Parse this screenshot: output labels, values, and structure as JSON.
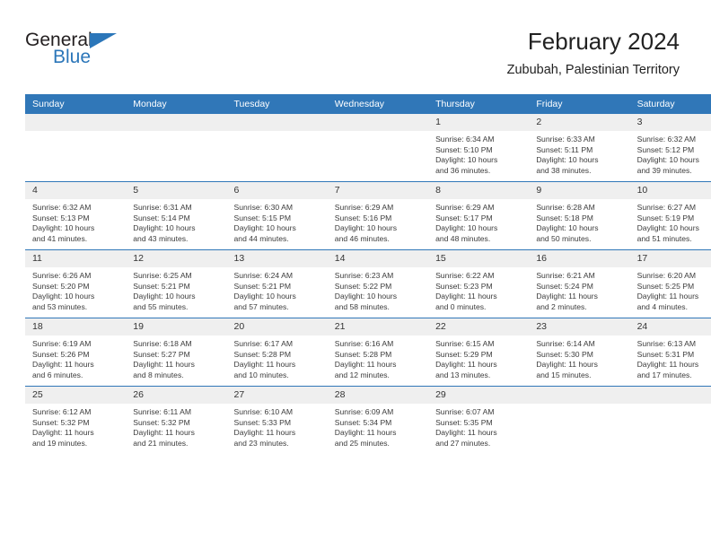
{
  "brand": {
    "name_part1": "General",
    "name_part2": "Blue"
  },
  "header": {
    "title": "February 2024",
    "subtitle": "Zububah, Palestinian Territory"
  },
  "colors": {
    "header_blue": "#3077b8",
    "brand_blue": "#2b76b9",
    "daynum_band": "#efefef",
    "text": "#3b3b3b"
  },
  "weekday_headers": [
    "Sunday",
    "Monday",
    "Tuesday",
    "Wednesday",
    "Thursday",
    "Friday",
    "Saturday"
  ],
  "weeks": [
    [
      {
        "day": "",
        "blank": true,
        "sunrise": "",
        "sunset": "",
        "daylight_l1": "",
        "daylight_l2": ""
      },
      {
        "day": "",
        "blank": true,
        "sunrise": "",
        "sunset": "",
        "daylight_l1": "",
        "daylight_l2": ""
      },
      {
        "day": "",
        "blank": true,
        "sunrise": "",
        "sunset": "",
        "daylight_l1": "",
        "daylight_l2": ""
      },
      {
        "day": "",
        "blank": true,
        "sunrise": "",
        "sunset": "",
        "daylight_l1": "",
        "daylight_l2": ""
      },
      {
        "day": "1",
        "blank": false,
        "sunrise": "Sunrise: 6:34 AM",
        "sunset": "Sunset: 5:10 PM",
        "daylight_l1": "Daylight: 10 hours",
        "daylight_l2": "and 36 minutes."
      },
      {
        "day": "2",
        "blank": false,
        "sunrise": "Sunrise: 6:33 AM",
        "sunset": "Sunset: 5:11 PM",
        "daylight_l1": "Daylight: 10 hours",
        "daylight_l2": "and 38 minutes."
      },
      {
        "day": "3",
        "blank": false,
        "sunrise": "Sunrise: 6:32 AM",
        "sunset": "Sunset: 5:12 PM",
        "daylight_l1": "Daylight: 10 hours",
        "daylight_l2": "and 39 minutes."
      }
    ],
    [
      {
        "day": "4",
        "blank": false,
        "sunrise": "Sunrise: 6:32 AM",
        "sunset": "Sunset: 5:13 PM",
        "daylight_l1": "Daylight: 10 hours",
        "daylight_l2": "and 41 minutes."
      },
      {
        "day": "5",
        "blank": false,
        "sunrise": "Sunrise: 6:31 AM",
        "sunset": "Sunset: 5:14 PM",
        "daylight_l1": "Daylight: 10 hours",
        "daylight_l2": "and 43 minutes."
      },
      {
        "day": "6",
        "blank": false,
        "sunrise": "Sunrise: 6:30 AM",
        "sunset": "Sunset: 5:15 PM",
        "daylight_l1": "Daylight: 10 hours",
        "daylight_l2": "and 44 minutes."
      },
      {
        "day": "7",
        "blank": false,
        "sunrise": "Sunrise: 6:29 AM",
        "sunset": "Sunset: 5:16 PM",
        "daylight_l1": "Daylight: 10 hours",
        "daylight_l2": "and 46 minutes."
      },
      {
        "day": "8",
        "blank": false,
        "sunrise": "Sunrise: 6:29 AM",
        "sunset": "Sunset: 5:17 PM",
        "daylight_l1": "Daylight: 10 hours",
        "daylight_l2": "and 48 minutes."
      },
      {
        "day": "9",
        "blank": false,
        "sunrise": "Sunrise: 6:28 AM",
        "sunset": "Sunset: 5:18 PM",
        "daylight_l1": "Daylight: 10 hours",
        "daylight_l2": "and 50 minutes."
      },
      {
        "day": "10",
        "blank": false,
        "sunrise": "Sunrise: 6:27 AM",
        "sunset": "Sunset: 5:19 PM",
        "daylight_l1": "Daylight: 10 hours",
        "daylight_l2": "and 51 minutes."
      }
    ],
    [
      {
        "day": "11",
        "blank": false,
        "sunrise": "Sunrise: 6:26 AM",
        "sunset": "Sunset: 5:20 PM",
        "daylight_l1": "Daylight: 10 hours",
        "daylight_l2": "and 53 minutes."
      },
      {
        "day": "12",
        "blank": false,
        "sunrise": "Sunrise: 6:25 AM",
        "sunset": "Sunset: 5:21 PM",
        "daylight_l1": "Daylight: 10 hours",
        "daylight_l2": "and 55 minutes."
      },
      {
        "day": "13",
        "blank": false,
        "sunrise": "Sunrise: 6:24 AM",
        "sunset": "Sunset: 5:21 PM",
        "daylight_l1": "Daylight: 10 hours",
        "daylight_l2": "and 57 minutes."
      },
      {
        "day": "14",
        "blank": false,
        "sunrise": "Sunrise: 6:23 AM",
        "sunset": "Sunset: 5:22 PM",
        "daylight_l1": "Daylight: 10 hours",
        "daylight_l2": "and 58 minutes."
      },
      {
        "day": "15",
        "blank": false,
        "sunrise": "Sunrise: 6:22 AM",
        "sunset": "Sunset: 5:23 PM",
        "daylight_l1": "Daylight: 11 hours",
        "daylight_l2": "and 0 minutes."
      },
      {
        "day": "16",
        "blank": false,
        "sunrise": "Sunrise: 6:21 AM",
        "sunset": "Sunset: 5:24 PM",
        "daylight_l1": "Daylight: 11 hours",
        "daylight_l2": "and 2 minutes."
      },
      {
        "day": "17",
        "blank": false,
        "sunrise": "Sunrise: 6:20 AM",
        "sunset": "Sunset: 5:25 PM",
        "daylight_l1": "Daylight: 11 hours",
        "daylight_l2": "and 4 minutes."
      }
    ],
    [
      {
        "day": "18",
        "blank": false,
        "sunrise": "Sunrise: 6:19 AM",
        "sunset": "Sunset: 5:26 PM",
        "daylight_l1": "Daylight: 11 hours",
        "daylight_l2": "and 6 minutes."
      },
      {
        "day": "19",
        "blank": false,
        "sunrise": "Sunrise: 6:18 AM",
        "sunset": "Sunset: 5:27 PM",
        "daylight_l1": "Daylight: 11 hours",
        "daylight_l2": "and 8 minutes."
      },
      {
        "day": "20",
        "blank": false,
        "sunrise": "Sunrise: 6:17 AM",
        "sunset": "Sunset: 5:28 PM",
        "daylight_l1": "Daylight: 11 hours",
        "daylight_l2": "and 10 minutes."
      },
      {
        "day": "21",
        "blank": false,
        "sunrise": "Sunrise: 6:16 AM",
        "sunset": "Sunset: 5:28 PM",
        "daylight_l1": "Daylight: 11 hours",
        "daylight_l2": "and 12 minutes."
      },
      {
        "day": "22",
        "blank": false,
        "sunrise": "Sunrise: 6:15 AM",
        "sunset": "Sunset: 5:29 PM",
        "daylight_l1": "Daylight: 11 hours",
        "daylight_l2": "and 13 minutes."
      },
      {
        "day": "23",
        "blank": false,
        "sunrise": "Sunrise: 6:14 AM",
        "sunset": "Sunset: 5:30 PM",
        "daylight_l1": "Daylight: 11 hours",
        "daylight_l2": "and 15 minutes."
      },
      {
        "day": "24",
        "blank": false,
        "sunrise": "Sunrise: 6:13 AM",
        "sunset": "Sunset: 5:31 PM",
        "daylight_l1": "Daylight: 11 hours",
        "daylight_l2": "and 17 minutes."
      }
    ],
    [
      {
        "day": "25",
        "blank": false,
        "sunrise": "Sunrise: 6:12 AM",
        "sunset": "Sunset: 5:32 PM",
        "daylight_l1": "Daylight: 11 hours",
        "daylight_l2": "and 19 minutes."
      },
      {
        "day": "26",
        "blank": false,
        "sunrise": "Sunrise: 6:11 AM",
        "sunset": "Sunset: 5:32 PM",
        "daylight_l1": "Daylight: 11 hours",
        "daylight_l2": "and 21 minutes."
      },
      {
        "day": "27",
        "blank": false,
        "sunrise": "Sunrise: 6:10 AM",
        "sunset": "Sunset: 5:33 PM",
        "daylight_l1": "Daylight: 11 hours",
        "daylight_l2": "and 23 minutes."
      },
      {
        "day": "28",
        "blank": false,
        "sunrise": "Sunrise: 6:09 AM",
        "sunset": "Sunset: 5:34 PM",
        "daylight_l1": "Daylight: 11 hours",
        "daylight_l2": "and 25 minutes."
      },
      {
        "day": "29",
        "blank": false,
        "sunrise": "Sunrise: 6:07 AM",
        "sunset": "Sunset: 5:35 PM",
        "daylight_l1": "Daylight: 11 hours",
        "daylight_l2": "and 27 minutes."
      },
      {
        "day": "",
        "blank": true,
        "sunrise": "",
        "sunset": "",
        "daylight_l1": "",
        "daylight_l2": ""
      },
      {
        "day": "",
        "blank": true,
        "sunrise": "",
        "sunset": "",
        "daylight_l1": "",
        "daylight_l2": ""
      }
    ]
  ]
}
